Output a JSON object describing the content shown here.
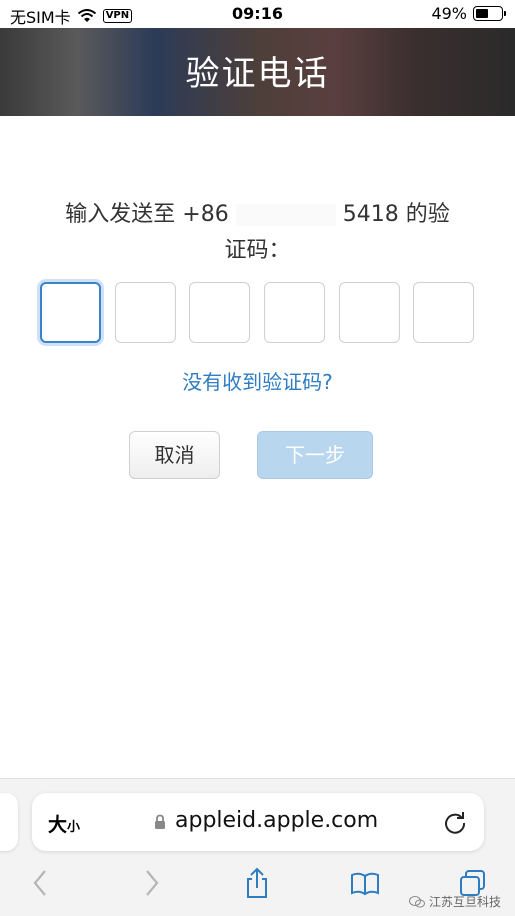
{
  "status_bar": {
    "carrier": "无SIM卡",
    "vpn": "VPN",
    "time": "09:16",
    "battery": "49%"
  },
  "header": {
    "title": "验证电话"
  },
  "verify": {
    "prompt_start": "输入发送至 +86",
    "prompt_end": "5418 的验",
    "prompt_line2": "证码：",
    "code_boxes": [
      "",
      "",
      "",
      "",
      "",
      ""
    ],
    "no_code_link": "没有收到验证码?",
    "cancel_label": "取消",
    "next_label": "下一步"
  },
  "browser": {
    "text_size_label": "大",
    "text_size_small": "小",
    "url": "appleid.apple.com"
  },
  "watermark": "江苏互旦科技",
  "colors": {
    "link_blue": "#2f7dc1",
    "next_button": "#b9d6ef",
    "active_box": "#3b82c8"
  }
}
